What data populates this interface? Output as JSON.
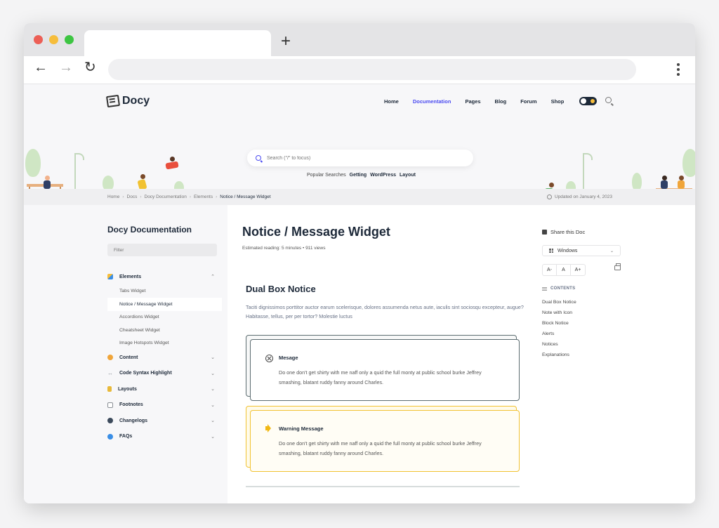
{
  "site": {
    "brand": "Docy",
    "nav": [
      "Home",
      "Documentation",
      "Pages",
      "Blog",
      "Forum",
      "Shop"
    ],
    "active_nav": "Documentation",
    "search_placeholder": "Search (\"/\" to focus)",
    "popular_label": "Popular Searches",
    "popular_terms": [
      "Getting",
      "WordPress",
      "Layout"
    ]
  },
  "breadcrumb": [
    "Home",
    "Docs",
    "Docy Documentation",
    "Elements",
    "Notice / Message Widget"
  ],
  "updated": "Updated on January 4, 2023",
  "sidebar": {
    "title": "Docy Documentation",
    "filter_placeholder": "Filter",
    "sections": [
      {
        "label": "Elements",
        "icon": "grid-icon",
        "color": "#f6bd3b",
        "expanded": true,
        "children": [
          "Tabs Widget",
          "Notice / Message Widget",
          "Accordions Widget",
          "Cheatsheet Widget",
          "Image Hotspots Widget"
        ]
      },
      {
        "label": "Content",
        "icon": "content-icon",
        "color": "#f0a53a"
      },
      {
        "label": "Code Syntax Highlight",
        "icon": "code-icon",
        "color": "#9aa0a6"
      },
      {
        "label": "Layouts",
        "icon": "layouts-icon",
        "color": "#e8b93a"
      },
      {
        "label": "Footnotes",
        "icon": "footnotes-icon",
        "color": "#8a8f95"
      },
      {
        "label": "Changelogs",
        "icon": "changelogs-icon",
        "color": "#3c4a5c"
      },
      {
        "label": "FAQs",
        "icon": "faqs-icon",
        "color": "#3a8ee6"
      }
    ],
    "active_child": "Notice / Message Widget"
  },
  "main": {
    "title": "Notice / Message Widget",
    "meta": "Estimated reading: 5 minutes  •  911 views",
    "section_title": "Dual Box Notice",
    "section_desc": "Taciti dignissimos porttitor auctor earum scelerisque, dolores assumenda netus aute, iaculis sint sociosqu excepteur, augue? Habitasse, tellus, per per tortor? Molestie luctus",
    "notices": [
      {
        "title": "Mesage",
        "text": "Do one don't get shirty with me naff only a quid the full monty at public school burke Jeffrey smashing, blatant ruddy fanny around Charles.",
        "icon": "close-circle-icon"
      },
      {
        "title": "Warning Message",
        "text": "Do one don't get shirty with me naff only a quid the full monty at public school burke Jeffrey smashing, blatant ruddy fanny around Charles.",
        "icon": "speaker-icon"
      }
    ]
  },
  "right": {
    "share": "Share this Doc",
    "os_selected": "Windows",
    "font_controls": [
      "A-",
      "A",
      "A+"
    ],
    "toc_heading": "CONTENTS",
    "toc": [
      "Dual Box Notice",
      "Note with Icon",
      "Block Notice",
      "Alerts",
      "Notices",
      "Explanations"
    ]
  }
}
